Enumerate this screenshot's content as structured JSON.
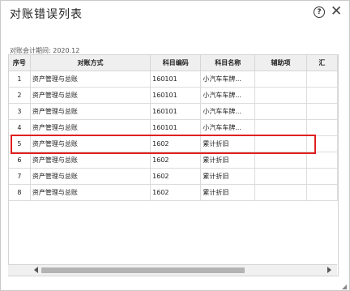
{
  "dialog": {
    "title": "对账错误列表",
    "help_icon": "help-circle-icon",
    "close_icon": "close-icon",
    "period_label": "对账会计期间: 2020.12"
  },
  "table": {
    "columns": [
      "序号",
      "对账方式",
      "科目编码",
      "科目名称",
      "辅助项",
      "汇"
    ],
    "rows": [
      {
        "seq": "1",
        "method": "资产管理与总账",
        "code": "160101",
        "name": "小汽车车牌...",
        "aux": ""
      },
      {
        "seq": "2",
        "method": "资产管理与总账",
        "code": "160101",
        "name": "小汽车车牌...",
        "aux": ""
      },
      {
        "seq": "3",
        "method": "资产管理与总账",
        "code": "160101",
        "name": "小汽车车牌...",
        "aux": ""
      },
      {
        "seq": "4",
        "method": "资产管理与总账",
        "code": "160101",
        "name": "小汽车车牌...",
        "aux": ""
      },
      {
        "seq": "5",
        "method": "资产管理与总账",
        "code": "1602",
        "name": "累计折旧",
        "aux": ""
      },
      {
        "seq": "6",
        "method": "资产管理与总账",
        "code": "1602",
        "name": "累计折旧",
        "aux": ""
      },
      {
        "seq": "7",
        "method": "资产管理与总账",
        "code": "1602",
        "name": "累计折旧",
        "aux": ""
      },
      {
        "seq": "8",
        "method": "资产管理与总账",
        "code": "1602",
        "name": "累计折旧",
        "aux": ""
      }
    ],
    "highlighted_row": "5"
  },
  "colors": {
    "highlight": "#e02020",
    "header_bg": "#efefef"
  }
}
